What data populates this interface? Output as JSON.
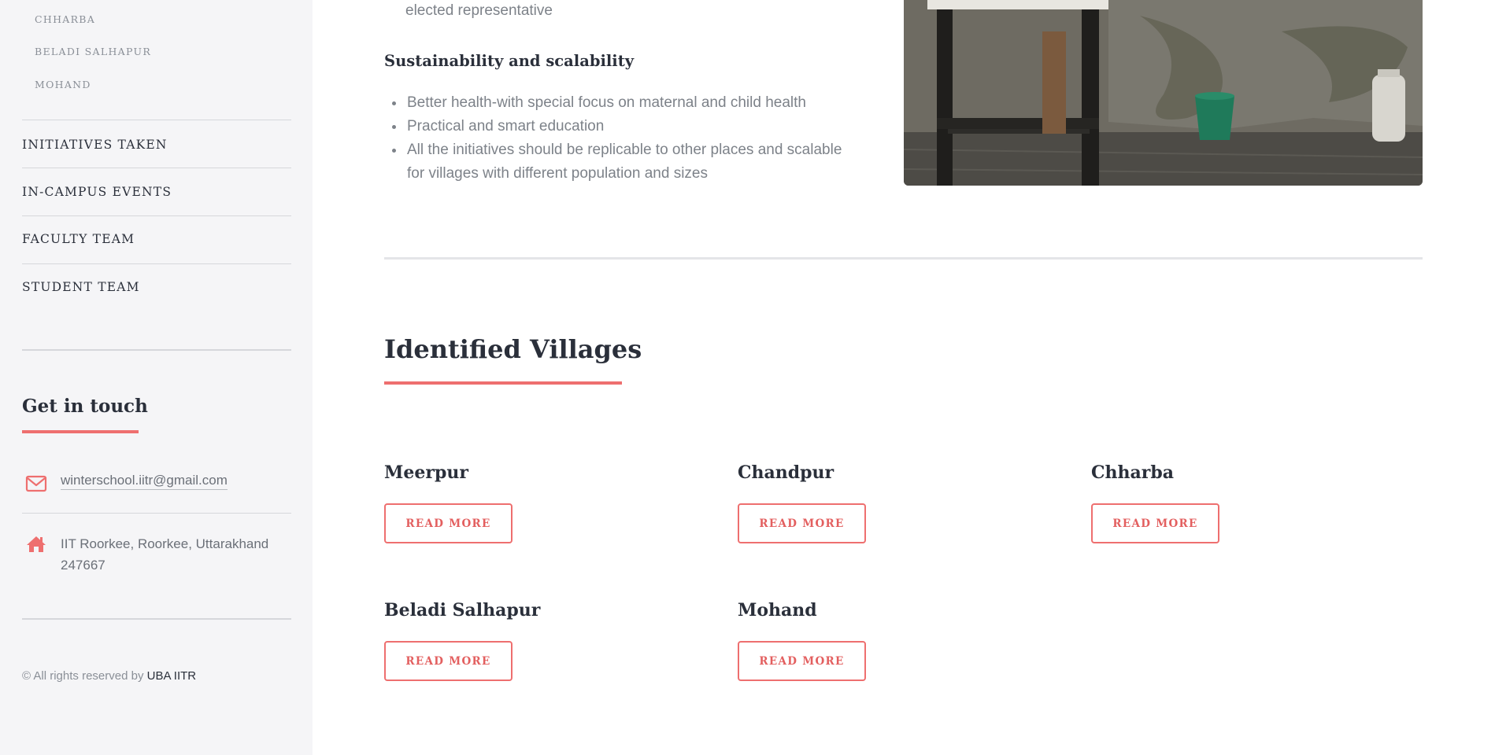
{
  "sidebar": {
    "sub_items": [
      "CHHARBA",
      "BELADI SALHAPUR",
      "MOHAND"
    ],
    "nav_items": [
      "INITIATIVES TAKEN",
      "IN-CAMPUS EVENTS",
      "FACULTY TEAM",
      "STUDENT TEAM"
    ],
    "contact": {
      "title": "Get in touch",
      "email": "winterschool.iitr@gmail.com",
      "address": "IIT Roorkee, Roorkee, Uttarakhand 247667",
      "email_icon": "envelope-icon",
      "address_icon": "home-icon"
    },
    "copyright": {
      "text": "© All rights reserved by ",
      "brand": "UBA IITR"
    }
  },
  "main": {
    "top_text": "elected representative",
    "sustainability": {
      "heading": "Sustainability and scalability",
      "bullets": [
        "Better health-with special focus on maternal and child health",
        "Practical and smart education",
        "All the initiatives should be replicable to other places and scalable for villages with different population and sizes"
      ]
    },
    "villages_heading": "Identified Villages",
    "villages": [
      {
        "name": "Meerpur",
        "button": "READ MORE"
      },
      {
        "name": "Chandpur",
        "button": "READ MORE"
      },
      {
        "name": "Chharba",
        "button": "READ MORE"
      },
      {
        "name": "Beladi Salhapur",
        "button": "READ MORE"
      },
      {
        "name": "Mohand",
        "button": "READ MORE"
      }
    ]
  },
  "colors": {
    "accent": "#ee6f6f",
    "sidebar_bg": "#f5f5f7",
    "heading": "#2a2f3a",
    "body_text": "#7d8289"
  }
}
